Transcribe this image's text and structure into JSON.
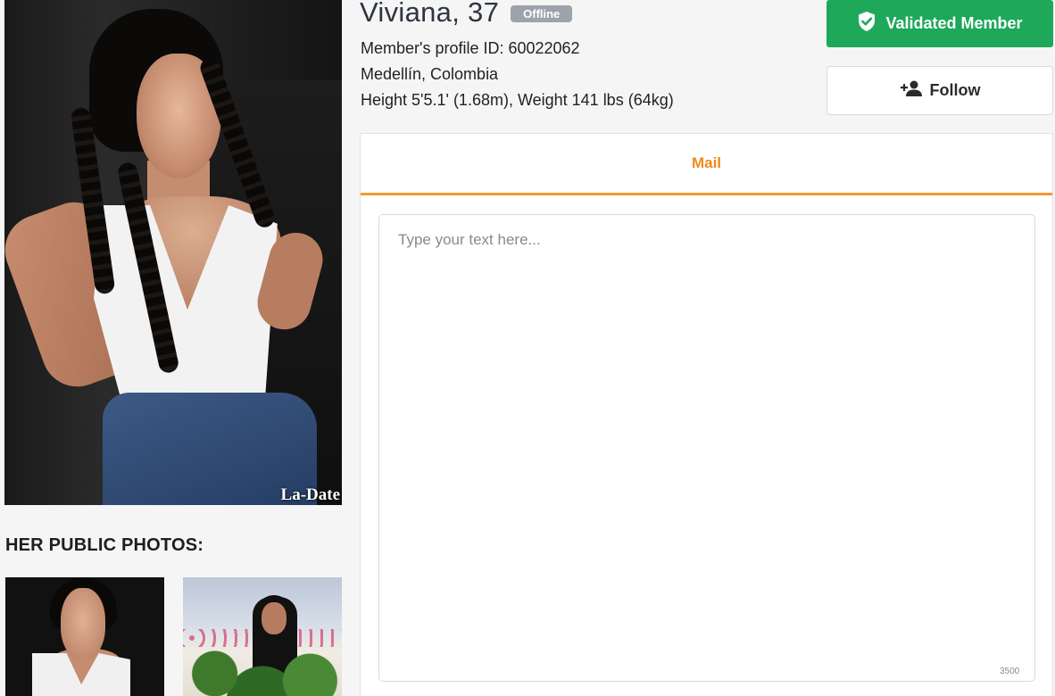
{
  "profile": {
    "name_age": "Viviana, 37",
    "status_badge": "Offline",
    "member_id": "Member's profile ID: 60022062",
    "location": "Medellín, Colombia",
    "body_stats": "Height 5'5.1' (1.68m), Weight 141 lbs (64kg)",
    "watermark": "La-Date"
  },
  "actions": {
    "validated_label": "Validated Member",
    "follow_label": "Follow"
  },
  "photos": {
    "section_title": "HER PUBLIC PHOTOS:"
  },
  "mail": {
    "tab_label": "Mail",
    "placeholder": "Type your text here...",
    "value": "",
    "char_limit": "3500"
  },
  "colors": {
    "accent_orange": "#ef8a1a",
    "validated_green": "#1ea85a",
    "offline_gray": "#9da3ab"
  },
  "icons": {
    "validated": "shield-check-icon",
    "follow": "person-add-icon"
  }
}
